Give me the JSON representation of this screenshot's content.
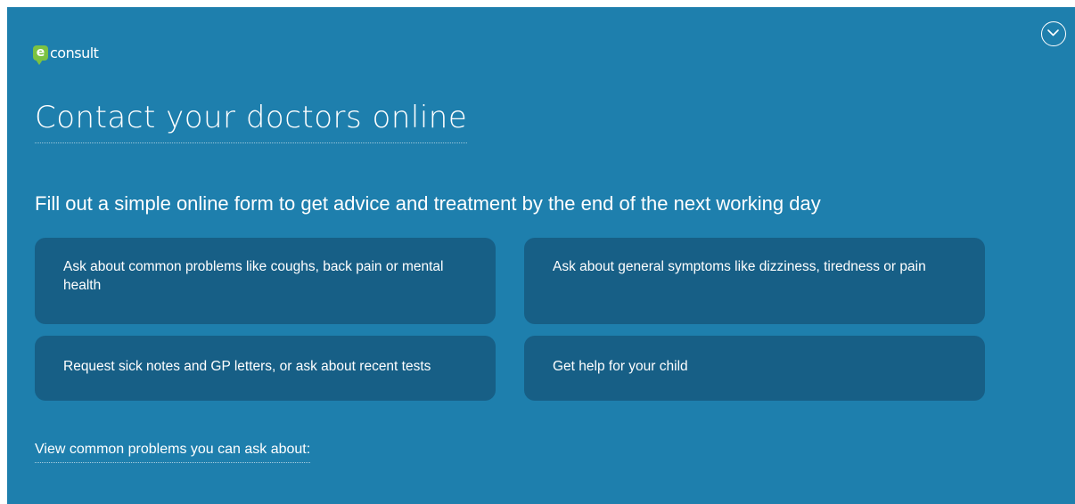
{
  "brand": {
    "badge_letter": "e",
    "name": "consult",
    "badge_color": "#7cc242"
  },
  "colors": {
    "panel_background": "#1e7fad",
    "card_background": "#175f86",
    "text": "#ffffff"
  },
  "header": {
    "collapse_icon": "chevron-down-circle-icon"
  },
  "main": {
    "title": "Contact your doctors online",
    "subtitle": "Fill out a simple online form to get advice and treatment by the end of the next working day",
    "cards": [
      {
        "label": "Ask about common problems like coughs, back pain or mental health"
      },
      {
        "label": "Ask about general symptoms like dizziness, tiredness or pain"
      },
      {
        "label": "Request sick notes and GP letters, or ask about recent tests"
      },
      {
        "label": "Get help for your child"
      }
    ],
    "view_link": "View common problems you can ask about:"
  }
}
